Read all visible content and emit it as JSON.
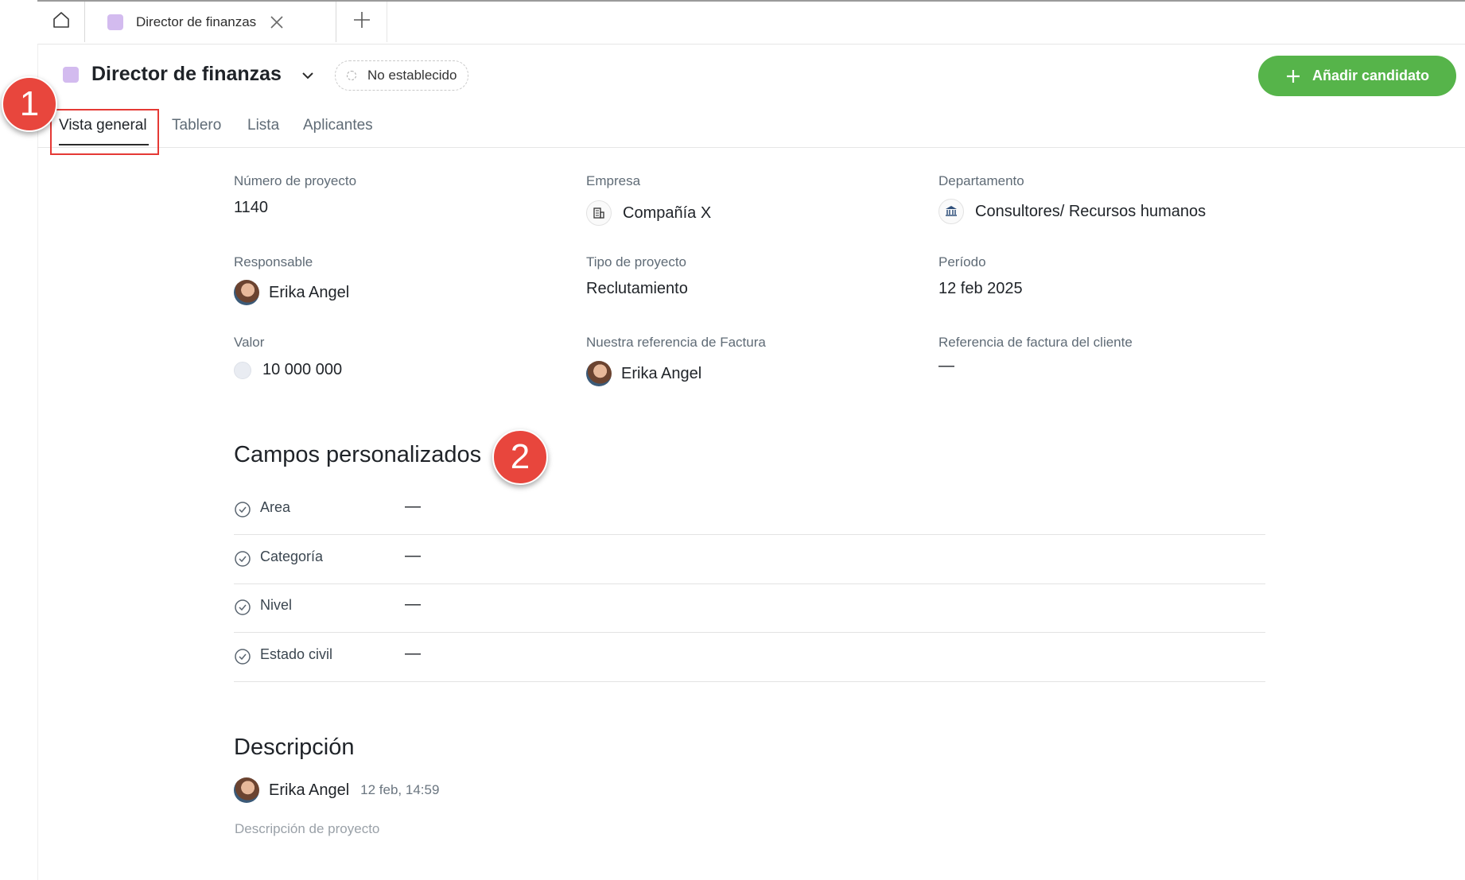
{
  "colors": {
    "accent_green": "#56b44a",
    "project_swatch": "#d3bbef",
    "callout_red": "#e8463d",
    "highlight_red": "#e53935"
  },
  "tabbar": {
    "home_icon": "home-icon",
    "tab_label": "Director de finanzas",
    "close_icon": "close-icon",
    "new_tab_icon": "plus-icon"
  },
  "header": {
    "title": "Director de finanzas",
    "status": "No establecido",
    "add_button": "Añadir candidato"
  },
  "subtabs": [
    "Vista general",
    "Tablero",
    "Lista",
    "Aplicantes"
  ],
  "callouts": [
    "1",
    "2"
  ],
  "fields": {
    "project_number": {
      "label": "Número de proyecto",
      "value": "1140"
    },
    "company": {
      "label": "Empresa",
      "value": "Compañía X",
      "icon": "building-icon"
    },
    "department": {
      "label": "Departamento",
      "value": "Consultores/ Recursos humanos",
      "icon": "bank-logo-icon"
    },
    "owner": {
      "label": "Responsable",
      "value": "Erika Angel"
    },
    "project_type": {
      "label": "Tipo de proyecto",
      "value": "Reclutamiento"
    },
    "period": {
      "label": "Período",
      "value": "12 feb 2025"
    },
    "value": {
      "label": "Valor",
      "value": "10 000 000"
    },
    "our_invoice_ref": {
      "label": "Nuestra referencia de Factura",
      "value": "Erika Angel"
    },
    "client_invoice_ref": {
      "label": "Referencia de factura del cliente",
      "value": "—"
    }
  },
  "custom_fields": {
    "title": "Campos personalizados",
    "rows": [
      {
        "label": "Area",
        "value": "—"
      },
      {
        "label": "Categoría",
        "value": "—"
      },
      {
        "label": "Nivel",
        "value": "—"
      },
      {
        "label": "Estado civil",
        "value": "—"
      }
    ]
  },
  "description": {
    "title": "Descripción",
    "author": "Erika Angel",
    "timestamp": "12 feb, 14:59",
    "placeholder": "Descripción de proyecto"
  }
}
